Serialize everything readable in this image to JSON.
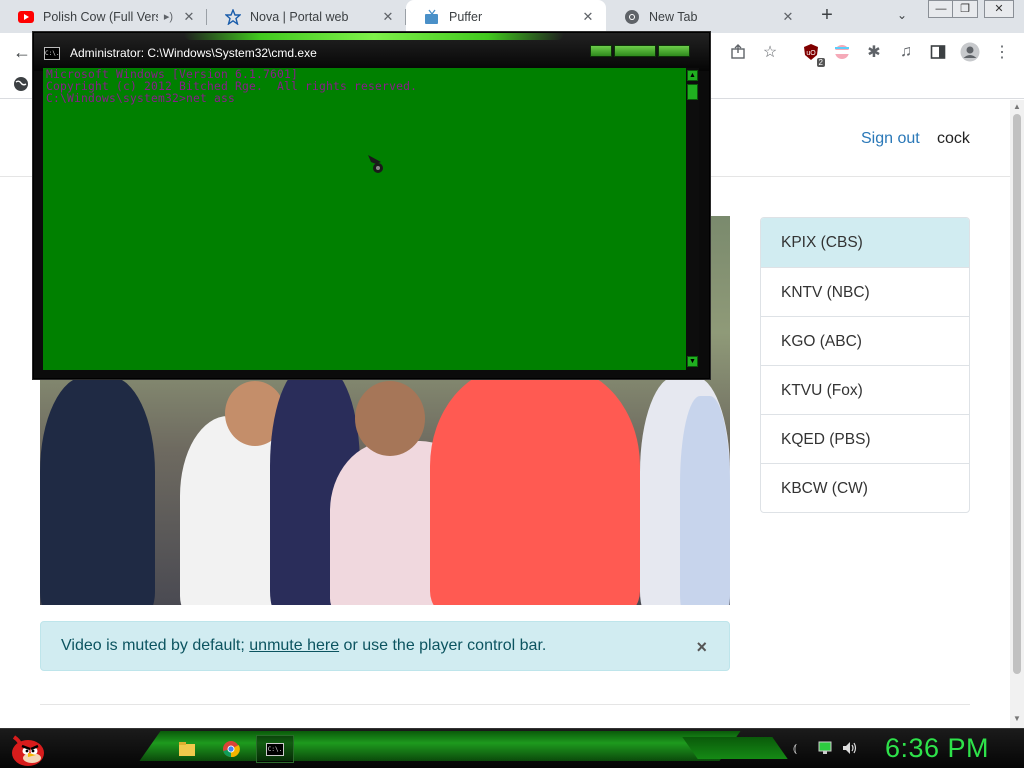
{
  "browser": {
    "tabs": [
      {
        "title": "Polish Cow (Full Versi",
        "favicon": "youtube-icon",
        "audio": true
      },
      {
        "title": "Nova | Portal web",
        "favicon": "star-outline-icon"
      },
      {
        "title": "Puffer",
        "favicon": "tv-icon",
        "active": true
      },
      {
        "title": "New Tab",
        "favicon": "chrome-icon"
      }
    ],
    "new_tab_label": "+",
    "toolbar_badge": "2"
  },
  "header": {
    "sign_out": "Sign out",
    "username": "cock"
  },
  "channels": [
    {
      "label": "KPIX (CBS)",
      "active": true
    },
    {
      "label": "KNTV (NBC)"
    },
    {
      "label": "KGO (ABC)"
    },
    {
      "label": "KTVU (Fox)"
    },
    {
      "label": "KQED (PBS)"
    },
    {
      "label": "KBCW (CW)"
    }
  ],
  "alert": {
    "before": "Video is muted by default; ",
    "link": "unmute here",
    "after": " or use the player control bar.",
    "close": "×"
  },
  "cmd": {
    "title": "Administrator: C:\\Windows\\System32\\cmd.exe",
    "icon_label": "C:\\.",
    "lines": [
      "Microsoft Windows [Version 6.1.7601]",
      "Copyright (c) 2012 Bitched Rge.  All rights reserved.",
      "",
      "C:\\Windows\\system32>net ass"
    ],
    "text_color": "#8a1a8c",
    "bg_color": "#008000"
  },
  "taskbar": {
    "clock": "6:36 PM",
    "apps": [
      "file-explorer-icon",
      "chrome-icon",
      "cmd-icon"
    ],
    "cmd_icon_label": "C:\\."
  }
}
